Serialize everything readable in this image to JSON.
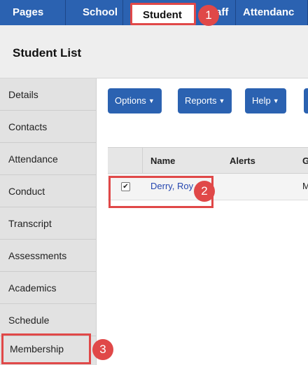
{
  "topnav": {
    "tabs": [
      {
        "label": "Pages"
      },
      {
        "label": "School"
      },
      {
        "label": "Student",
        "active": true
      },
      {
        "label": "aff"
      },
      {
        "label": "Attendanc"
      }
    ]
  },
  "page": {
    "title": "Student List"
  },
  "sidebar": {
    "items": [
      {
        "label": "Details"
      },
      {
        "label": "Contacts"
      },
      {
        "label": "Attendance"
      },
      {
        "label": "Conduct"
      },
      {
        "label": "Transcript"
      },
      {
        "label": "Assessments"
      },
      {
        "label": "Academics"
      },
      {
        "label": "Schedule"
      },
      {
        "label": "Membership"
      }
    ]
  },
  "toolbar": {
    "buttons": [
      {
        "label": "Options"
      },
      {
        "label": "Reports"
      },
      {
        "label": "Help"
      }
    ]
  },
  "table": {
    "headers": [
      "Name",
      "Alerts",
      "G"
    ],
    "rows": [
      {
        "name": "Derry, Roy",
        "alerts": "",
        "g": "M",
        "checked": true
      }
    ]
  },
  "callouts": [
    "1",
    "2",
    "3"
  ],
  "colors": {
    "nav_blue": "#2b62b1",
    "callout_red": "#e04848",
    "link_blue": "#2647b0"
  }
}
